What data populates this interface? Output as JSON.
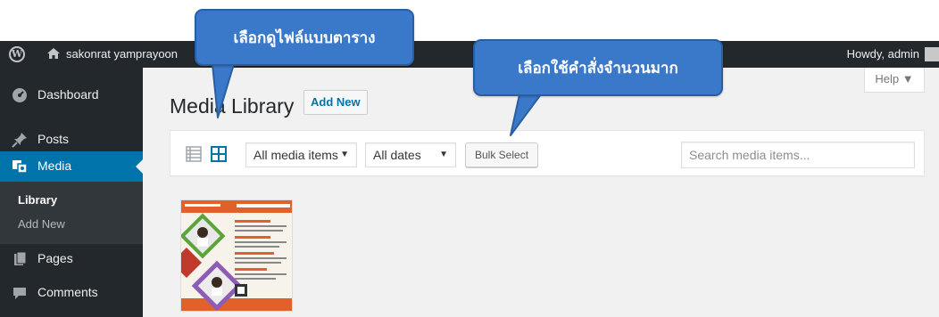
{
  "adminbar": {
    "site_name": "sakonrat yamprayoon",
    "howdy": "Howdy, admin"
  },
  "sidebar": {
    "items": [
      {
        "label": "Dashboard",
        "icon": "dashboard-icon"
      },
      {
        "label": "Posts",
        "icon": "pin-icon"
      },
      {
        "label": "Media",
        "icon": "media-icon",
        "active": true
      },
      {
        "label": "Pages",
        "icon": "pages-icon"
      },
      {
        "label": "Comments",
        "icon": "comment-icon"
      }
    ],
    "media_submenu": [
      "Library",
      "Add New"
    ]
  },
  "main": {
    "title": "Media Library",
    "add_new": "Add New",
    "help": "Help ▼"
  },
  "toolbar": {
    "media_filter": "All media items",
    "date_filter": "All dates",
    "bulk_select": "Bulk Select",
    "search_placeholder": "Search media items..."
  },
  "callouts": {
    "grid_view": "เลือกดูไฟล์แบบตาราง",
    "bulk_select": "เลือกใช้คำสั่งจำนวนมาก"
  },
  "colors": {
    "admin_dark": "#23282d",
    "accent": "#0073aa",
    "callout": "#3a78c9"
  }
}
